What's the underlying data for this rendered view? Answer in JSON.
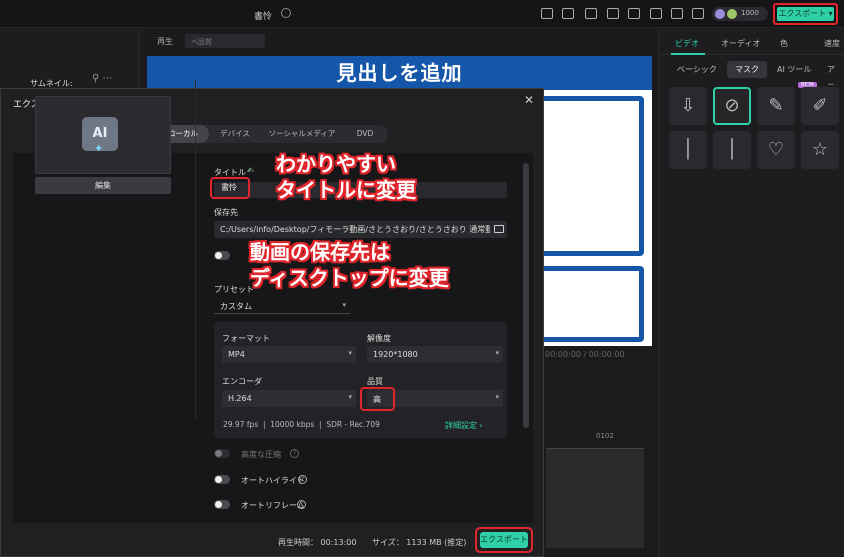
{
  "app": {
    "project_title": "書怜",
    "credits": "1000",
    "export_top_label": "エクスポート"
  },
  "preview": {
    "label": "再生",
    "select_placeholder": "ベ品質",
    "banner_text": "見出しを追加",
    "time_text": "00:00:00  /  00:00:00",
    "ruler_tick": "0102"
  },
  "right_panel": {
    "tabs": [
      "ビデオ",
      "オーディオ",
      "色",
      "速度"
    ],
    "subtabs": [
      "ベーシック",
      "マスク",
      "AI ツール",
      "アニメ"
    ],
    "beta": "BETA",
    "accent_color": "#2fd0a7"
  },
  "dialog": {
    "title": "エクスポート",
    "tabs": [
      "ローカル",
      "デバイス",
      "ソーシャルメディア",
      "DVD"
    ],
    "thumbnail_label": "サムネイル:",
    "thumbnail_ai_text": "AI",
    "edit_label": "編集",
    "title_label": "タイトル",
    "title_value": "書怜",
    "save_label": "保存先",
    "save_path": "C:/Users/info/Desktop/フィモーラ動画/さとうさおり/さとうさおり 通常動画/",
    "preset_label": "プリセット",
    "preset_value": "カスタム",
    "format_label": "フォーマット",
    "format_value": "MP4",
    "resolution_label": "解像度",
    "resolution_value": "1920*1080",
    "encoder_label": "エンコーダ",
    "encoder_value": "H.264",
    "quality_label": "品質",
    "quality_value": "高",
    "info_fps": "29.97 fps",
    "info_bitrate": "10000 kbps",
    "info_sdr": "SDR - Rec.709",
    "detail_link": "詳細設定",
    "opt_compress": "高度な圧縮",
    "opt_highlight": "オートハイライト",
    "opt_reframe": "オートリフレーム",
    "duration": "再生時間： 00:13:00",
    "size": "サイズ： 1133 MB (推定)",
    "export_label": "エクスポート"
  },
  "annotations": {
    "title_note_1": "わかりやすい",
    "title_note_2": "タイトルに変更",
    "save_note_1": "動画の保存先は",
    "save_note_2": "ディスクトップに変更"
  },
  "colors": {
    "accent": "#2fd0a7",
    "highlight_red": "#e0262b",
    "banner_blue": "#1556a8"
  }
}
